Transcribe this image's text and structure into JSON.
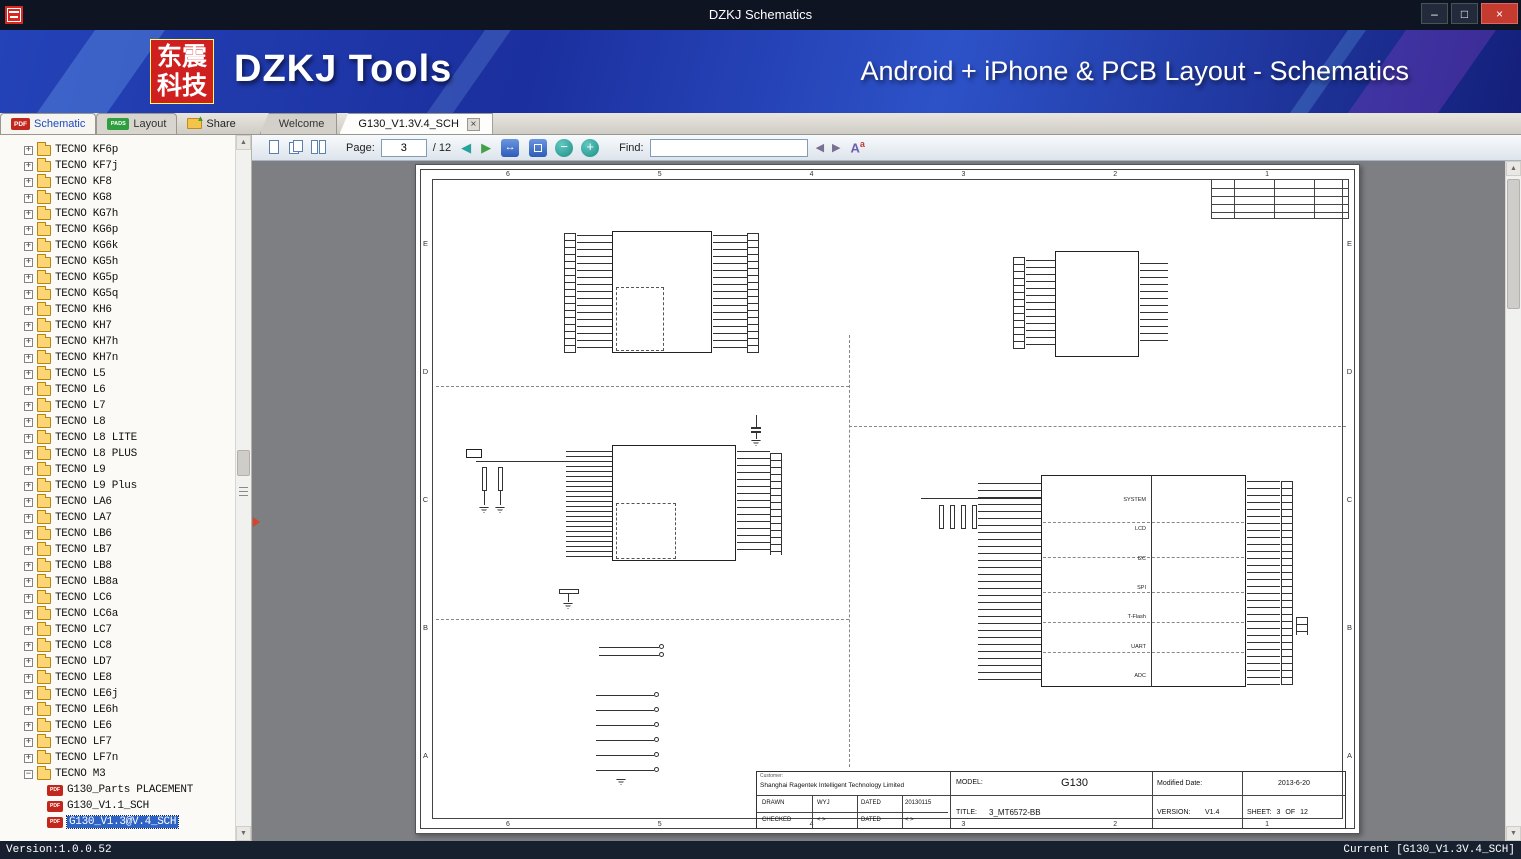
{
  "window": {
    "title": "DZKJ Schematics",
    "minimize_glyph": "–",
    "maximize_glyph": "□",
    "close_glyph": "×"
  },
  "banner": {
    "logo_text": "东震科技",
    "app_title": "DZKJ Tools",
    "subtitle": "Android + iPhone & PCB Layout - Schematics"
  },
  "icons": {
    "pdf": "PDF",
    "pads": "PADS"
  },
  "tabs": {
    "schematic_label": "Schematic",
    "layout_label": "Layout",
    "share_label": "Share",
    "doc_tabs": [
      {
        "label": "Welcome"
      },
      {
        "label": "G130_V1.3V.4_SCH"
      }
    ],
    "tab_close_glyph": "×"
  },
  "toolbar": {
    "page_label": "Page:",
    "page_value": "3",
    "page_total": "/ 12",
    "prev_glyph": "◀",
    "next_glyph": "▶",
    "fit_width_glyph": "↔",
    "zoom_out_glyph": "−",
    "zoom_in_glyph": "+",
    "find_label": "Find:",
    "find_value": "",
    "find_prev_glyph": "◀",
    "find_next_glyph": "▶",
    "case_big": "A",
    "case_small": "a"
  },
  "scrollbar": {
    "up": "▲",
    "down": "▼"
  },
  "sidebar": {
    "expand_glyph": "+",
    "collapse_glyph": "−",
    "folders": [
      "TECNO KF6p",
      "TECNO KF7j",
      "TECNO KF8",
      "TECNO KG8",
      "TECNO KG7h",
      "TECNO KG6p",
      "TECNO KG6k",
      "TECNO KG5h",
      "TECNO KG5p",
      "TECNO KG5q",
      "TECNO KH6",
      "TECNO KH7",
      "TECNO KH7h",
      "TECNO KH7n",
      "TECNO L5",
      "TECNO L6",
      "TECNO L7",
      "TECNO L8",
      "TECNO L8 LITE",
      "TECNO L8 PLUS",
      "TECNO L9",
      "TECNO L9 Plus",
      "TECNO LA6",
      "TECNO LA7",
      "TECNO LB6",
      "TECNO LB7",
      "TECNO LB8",
      "TECNO LB8a",
      "TECNO LC6",
      "TECNO LC6a",
      "TECNO LC7",
      "TECNO LC8",
      "TECNO LD7",
      "TECNO LE8",
      "TECNO LE6j",
      "TECNO LE6h",
      "TECNO LE6",
      "TECNO LF7",
      "TECNO LF7n"
    ],
    "expanded_folder": "TECNO M3",
    "children": [
      {
        "label": "G130_Parts PLACEMENT"
      },
      {
        "label": "G130_V1.1_SCH"
      },
      {
        "label": "G130_V1.3@V.4_SCH",
        "selected": true
      }
    ]
  },
  "schematic": {
    "zone_cols": [
      "6",
      "5",
      "4",
      "3",
      "2",
      "1"
    ],
    "zone_rows": [
      "E",
      "D",
      "C",
      "B",
      "A"
    ],
    "ic_sections": [
      "SYSTEM",
      "LCD",
      "I2C",
      "SPI",
      "T-Flash",
      "UART",
      "ADC"
    ],
    "title_block": {
      "customer_label": "Customer:",
      "company": "Shanghai Ragentek Intelligent Technology Limited",
      "model_label": "MODEL:",
      "model": "G130",
      "modified_label": "Modified Date:",
      "modified_date": "2013-6-20",
      "drawn_label": "DRAWN",
      "drawn": "WYJ",
      "dated_label": "DATED",
      "drawn_date": "20130115",
      "checked_label": "CHECKED",
      "checked": "< >",
      "checked_date": "< >",
      "title_label": "TITLE:",
      "title": "3_MT6572-BB",
      "version_label": "VERSION:",
      "version": "V1.4",
      "sheet_label": "SHEET:",
      "sheet": "3",
      "of_label": "OF",
      "sheet_total": "12"
    }
  },
  "statusbar": {
    "version": "Version:1.0.0.52",
    "current": "Current [G130_V1.3V.4_SCH]"
  }
}
